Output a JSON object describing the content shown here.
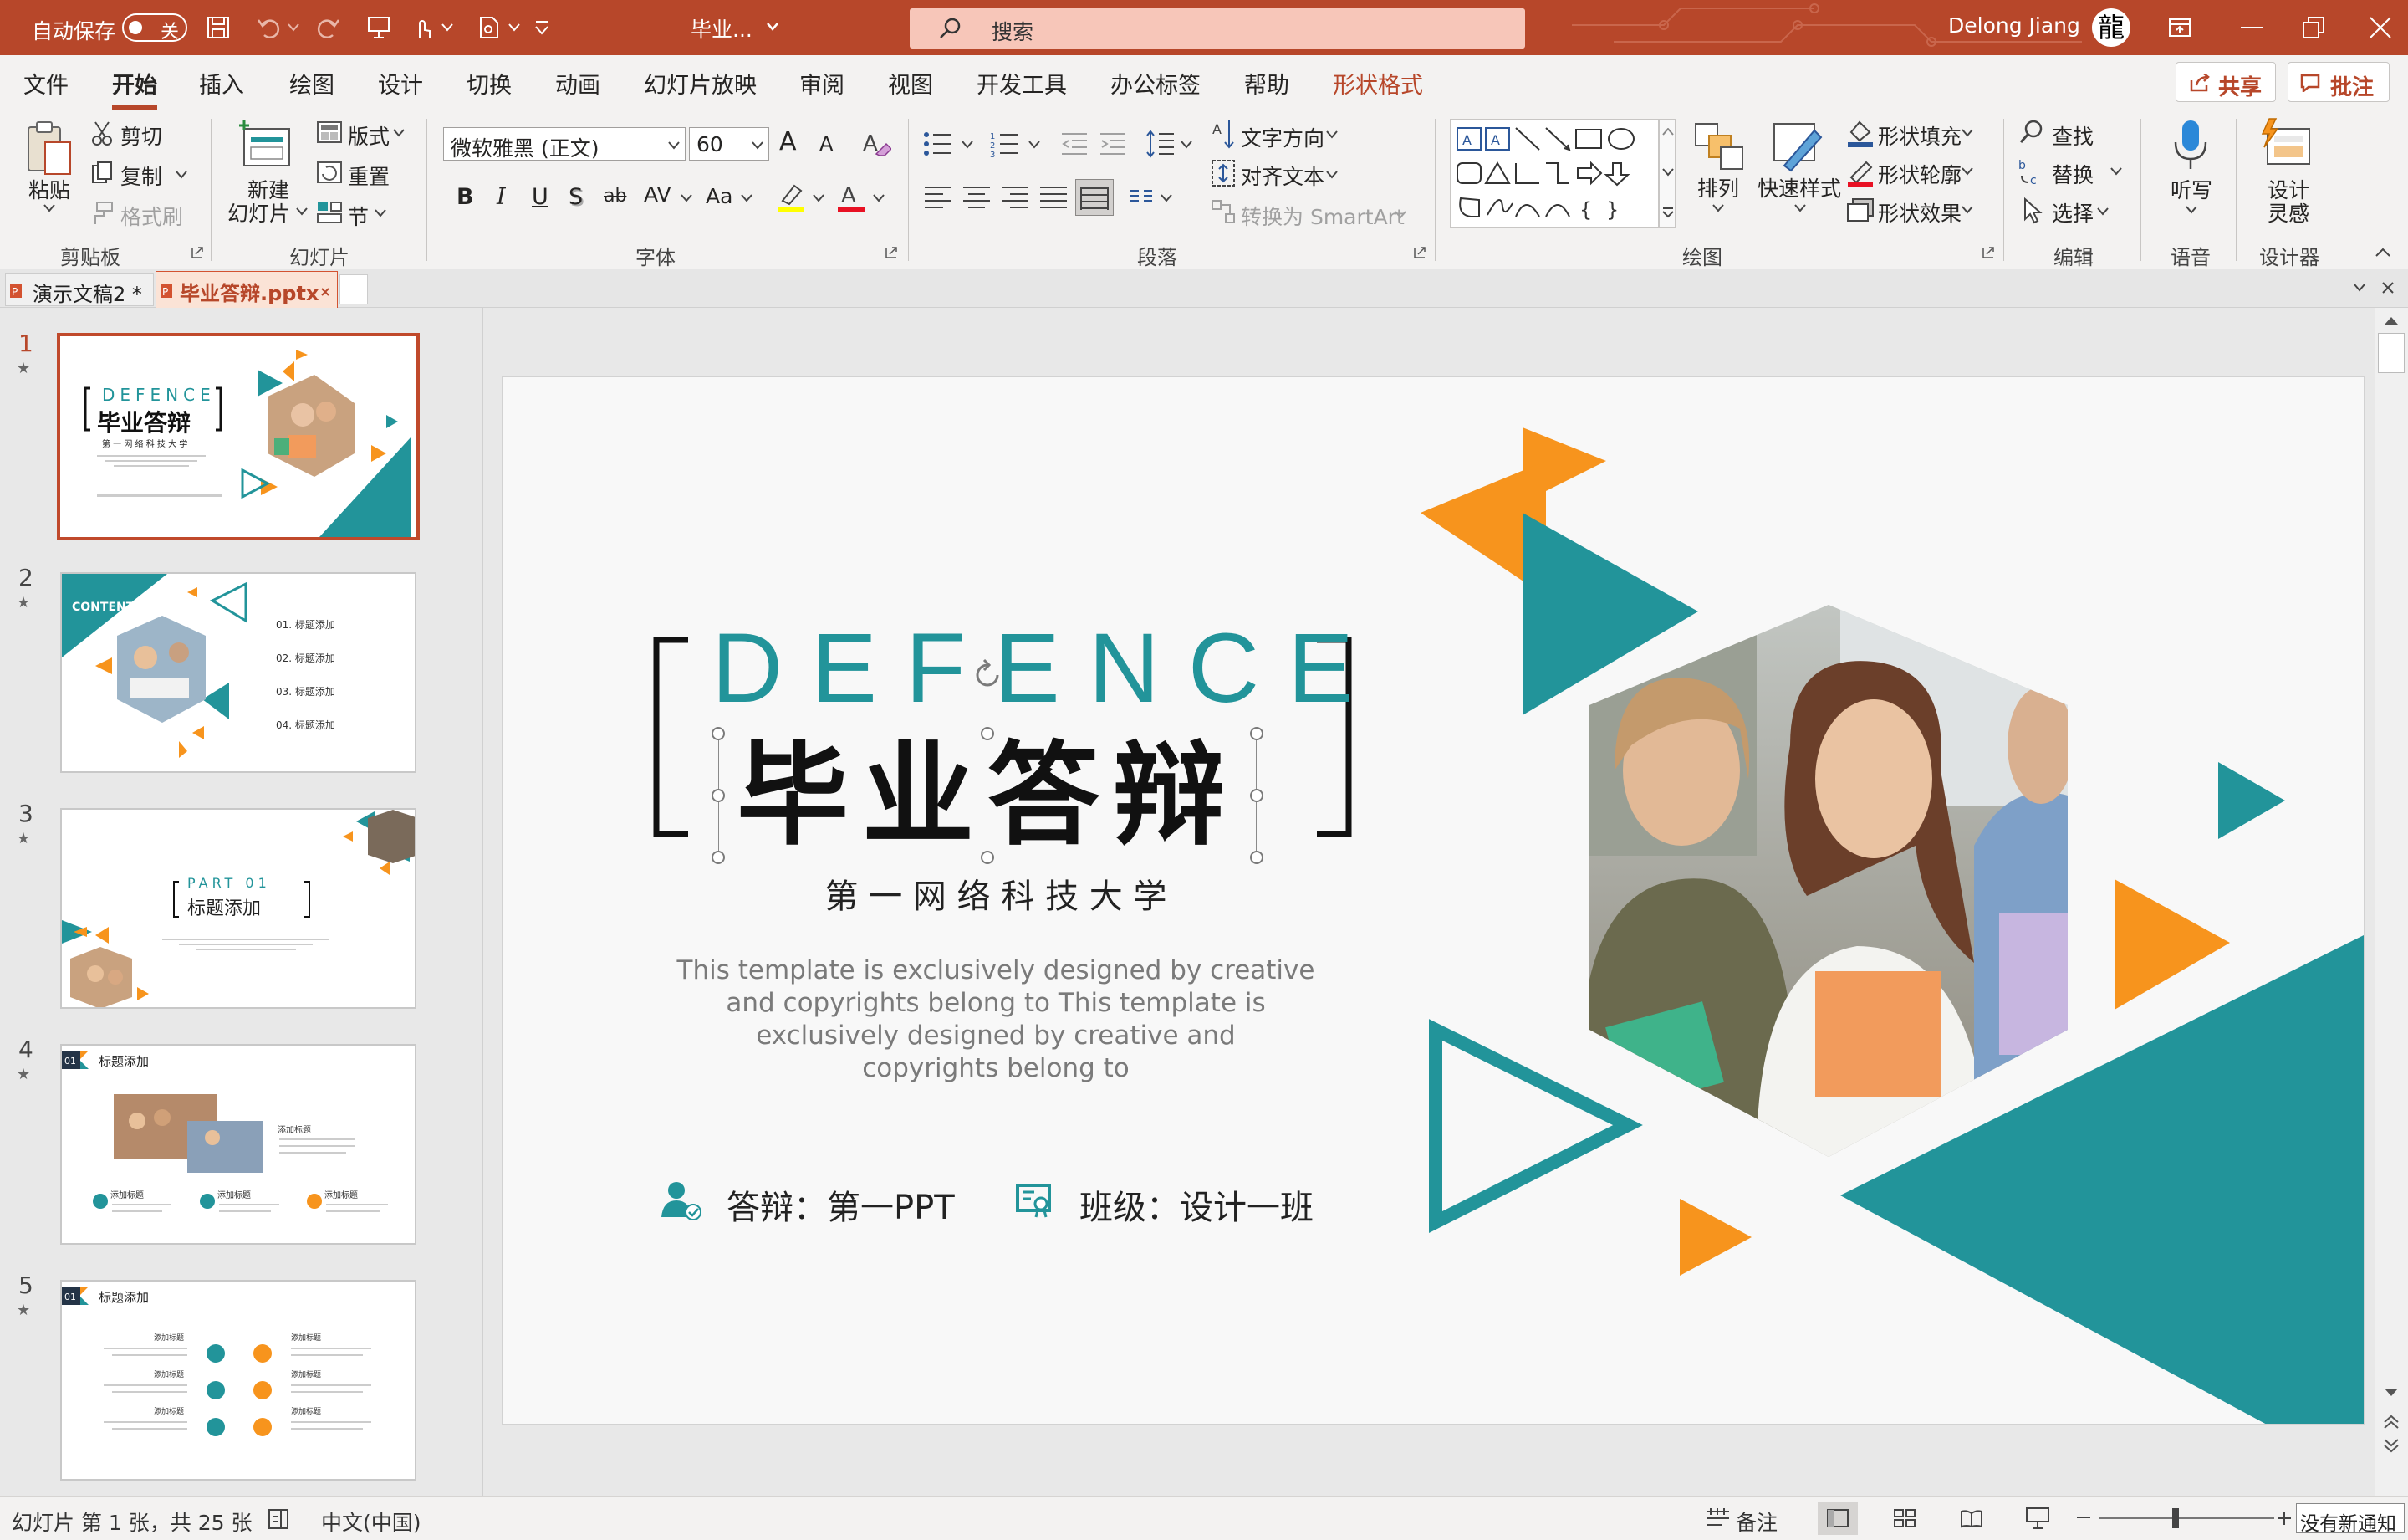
{
  "titlebar": {
    "autosave_label": "自动保存",
    "autosave_state": "关",
    "doc_title": "毕业...",
    "search_placeholder": "搜索",
    "user_name": "Delong Jiang",
    "avatar_char": "龍"
  },
  "ribbon_tabs": [
    "文件",
    "开始",
    "插入",
    "绘图",
    "设计",
    "切换",
    "动画",
    "幻灯片放映",
    "审阅",
    "视图",
    "开发工具",
    "办公标签",
    "帮助",
    "形状格式"
  ],
  "share_label": "共享",
  "comments_label": "批注",
  "clipboard": {
    "paste": "粘贴",
    "cut": "剪切",
    "copy": "复制",
    "format_painter": "格式刷",
    "group": "剪贴板"
  },
  "slides_group": {
    "new_slide_1": "新建",
    "new_slide_2": "幻灯片",
    "layout": "版式",
    "reset": "重置",
    "section": "节",
    "group": "幻灯片"
  },
  "font": {
    "name": "微软雅黑 (正文)",
    "size": "60",
    "bold": "B",
    "italic": "I",
    "underline": "U",
    "shadow": "S",
    "strike": "ab",
    "spacing": "AV",
    "case": "Aa",
    "grow": "A",
    "shrink": "A",
    "group": "字体"
  },
  "paragraph": {
    "text_direction": "文字方向",
    "align_text": "对齐文本",
    "smartart": "转换为 SmartArt",
    "group": "段落"
  },
  "drawing": {
    "arrange": "排列",
    "quick_styles": "快速样式",
    "shape_fill": "形状填充",
    "shape_outline": "形状轮廓",
    "shape_effects": "形状效果",
    "group": "绘图"
  },
  "editing": {
    "find": "查找",
    "replace": "替换",
    "select": "选择",
    "group": "编辑"
  },
  "voice": {
    "dictate": "听写",
    "group": "语音"
  },
  "designer": {
    "design_ideas_1": "设计",
    "design_ideas_2": "灵感",
    "group": "设计器"
  },
  "doc_tabs": [
    {
      "label": "演示文稿2 *"
    },
    {
      "label": "毕业答辩.pptx"
    }
  ],
  "thumbnails": [
    {
      "num": "1",
      "title_en": "DEFENCE",
      "title_cn": "毕业答辩",
      "sub": "第 一 网 络 科 技 大 学"
    },
    {
      "num": "2",
      "badge": "CONTENT",
      "items": [
        "01.  标题添加",
        "02.  标题添加",
        "03.  标题添加",
        "04.  标题添加"
      ]
    },
    {
      "num": "3",
      "part": "PART  01",
      "title": "标题添加"
    },
    {
      "num": "4",
      "title": "标题添加",
      "sub_items": [
        "添加标题",
        "添加标题",
        "添加标题",
        "添加标题"
      ]
    },
    {
      "num": "5",
      "title": "标题添加",
      "sub_items": [
        "添加标题",
        "添加标题",
        "添加标题",
        "添加标题",
        "添加标题",
        "添加标题"
      ]
    }
  ],
  "slide": {
    "title_en": "DEFENCE",
    "title_cn": "毕业答辩",
    "university": "第 一 网 络 科 技 大 学",
    "body_lines": [
      "This template is exclusively designed by  creative",
      "and copyrights belong to  This template is",
      "exclusively designed by  creative and",
      "copyrights belong to"
    ],
    "defender": "答辩：第一PPT",
    "class_info": "班级：设计一班",
    "colors": {
      "teal": "#22949a",
      "orange": "#f7941d"
    }
  },
  "status": {
    "slide_info": "幻灯片 第 1 张，共 25 张",
    "language": "中文(中国)",
    "notes": "备注",
    "notification": "没有新通知"
  }
}
